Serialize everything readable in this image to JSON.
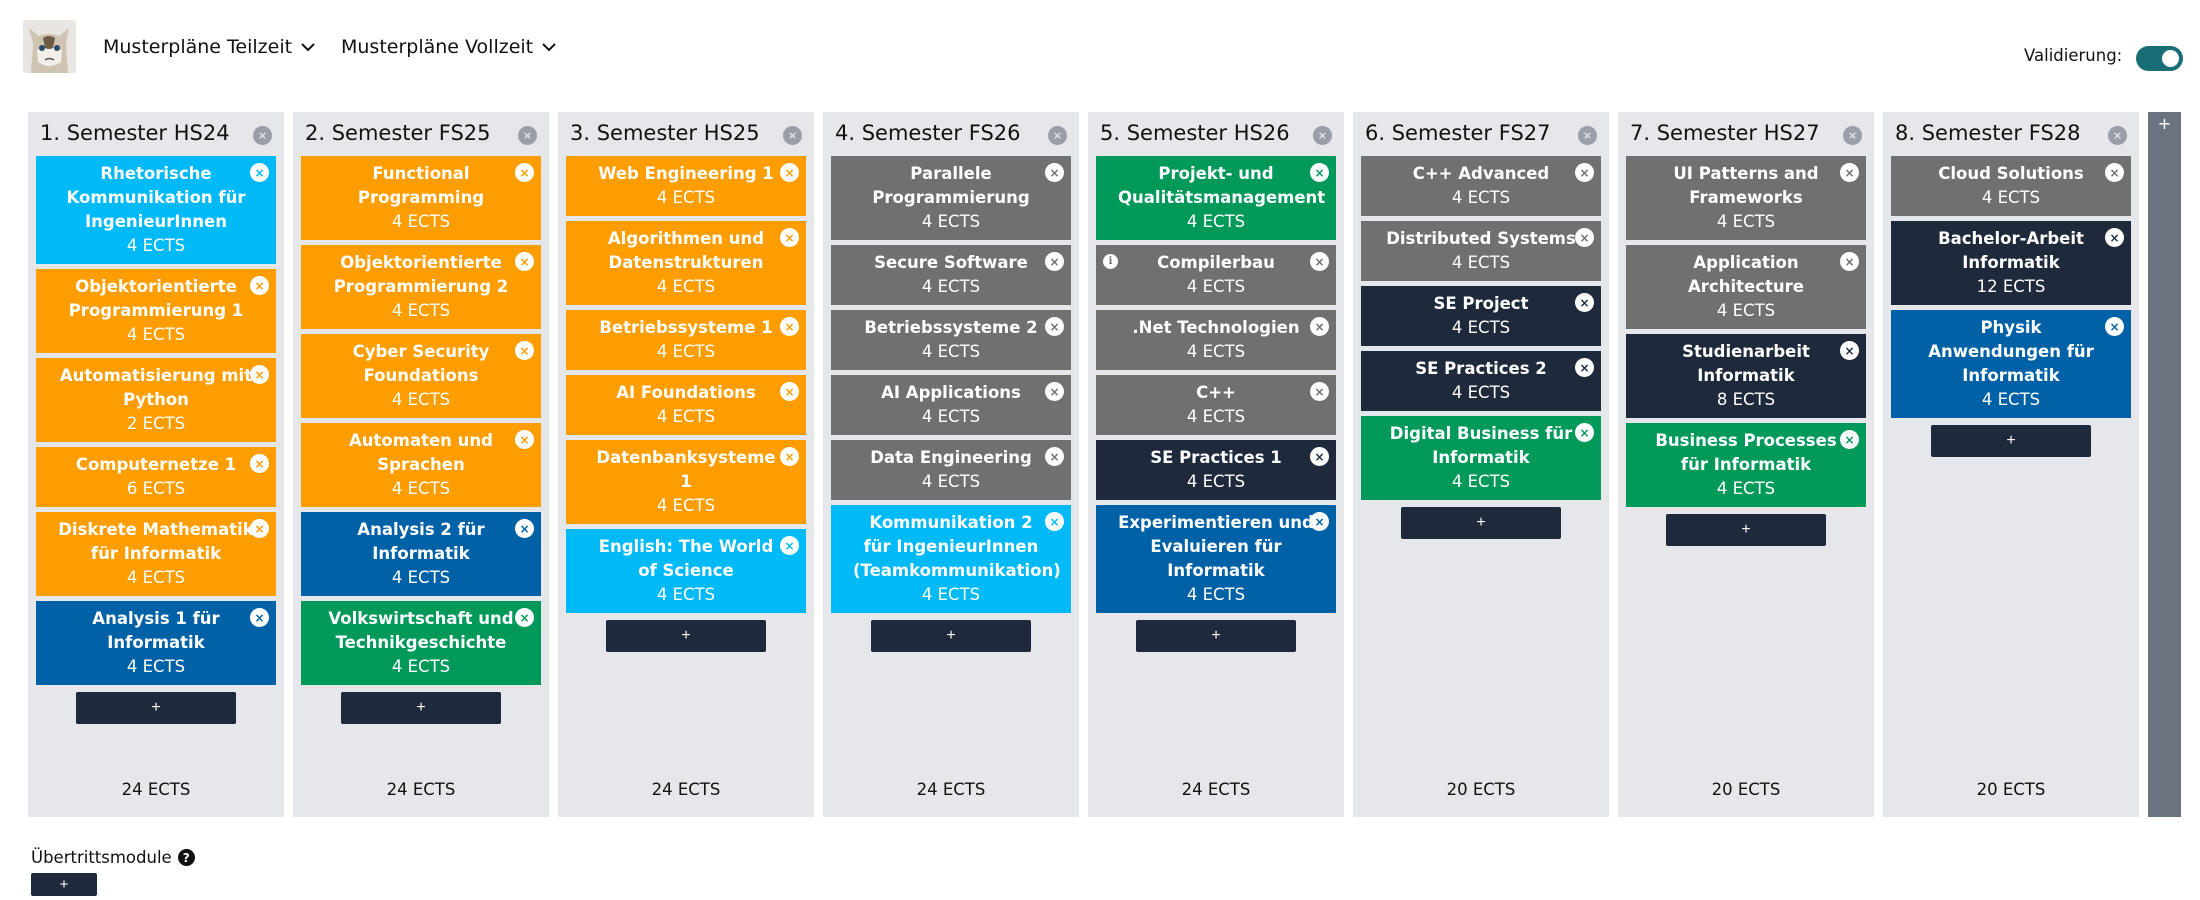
{
  "header": {
    "menu_parttime": "Musterpläne Teilzeit",
    "menu_fulltime": "Musterpläne Vollzeit",
    "validation_label": "Validierung:",
    "validation_on": true
  },
  "add_label": "+",
  "remove_glyph": "×",
  "info_glyph": "i",
  "semesters": [
    {
      "title": "1. Semester HS24",
      "total": "24 ECTS",
      "modules": [
        {
          "name": "Rhetorische Kommunikation für IngenieurInnen",
          "ects": "4 ECTS",
          "color": "cyan"
        },
        {
          "name": "Objektorientierte Programmierung 1",
          "ects": "4 ECTS",
          "color": "orange"
        },
        {
          "name": "Automatisierung mit Python",
          "ects": "2 ECTS",
          "color": "orange"
        },
        {
          "name": "Computernetze 1",
          "ects": "6 ECTS",
          "color": "orange"
        },
        {
          "name": "Diskrete Mathematik für Informatik",
          "ects": "4 ECTS",
          "color": "orange"
        },
        {
          "name": "Analysis 1 für Informatik",
          "ects": "4 ECTS",
          "color": "blue"
        }
      ]
    },
    {
      "title": "2. Semester FS25",
      "total": "24 ECTS",
      "modules": [
        {
          "name": "Functional Programming",
          "ects": "4 ECTS",
          "color": "orange"
        },
        {
          "name": "Objektorientierte Programmierung 2",
          "ects": "4 ECTS",
          "color": "orange"
        },
        {
          "name": "Cyber Security Foundations",
          "ects": "4 ECTS",
          "color": "orange"
        },
        {
          "name": "Automaten und Sprachen",
          "ects": "4 ECTS",
          "color": "orange"
        },
        {
          "name": "Analysis 2 für Informatik",
          "ects": "4 ECTS",
          "color": "blue"
        },
        {
          "name": "Volkswirtschaft und Technikgeschichte",
          "ects": "4 ECTS",
          "color": "green"
        }
      ]
    },
    {
      "title": "3. Semester HS25",
      "total": "24 ECTS",
      "modules": [
        {
          "name": "Web Engineering 1",
          "ects": "4 ECTS",
          "color": "orange"
        },
        {
          "name": "Algorithmen und Datenstrukturen",
          "ects": "4 ECTS",
          "color": "orange"
        },
        {
          "name": "Betriebssysteme 1",
          "ects": "4 ECTS",
          "color": "orange"
        },
        {
          "name": "AI Foundations",
          "ects": "4 ECTS",
          "color": "orange"
        },
        {
          "name": "Datenbanksysteme 1",
          "ects": "4 ECTS",
          "color": "orange"
        },
        {
          "name": "English: The World of Science",
          "ects": "4 ECTS",
          "color": "cyan"
        }
      ]
    },
    {
      "title": "4. Semester FS26",
      "total": "24 ECTS",
      "modules": [
        {
          "name": "Parallele Programmierung",
          "ects": "4 ECTS",
          "color": "gray"
        },
        {
          "name": "Secure Software",
          "ects": "4 ECTS",
          "color": "gray"
        },
        {
          "name": "Betriebssysteme 2",
          "ects": "4 ECTS",
          "color": "gray"
        },
        {
          "name": "AI Applications",
          "ects": "4 ECTS",
          "color": "gray"
        },
        {
          "name": "Data Engineering",
          "ects": "4 ECTS",
          "color": "gray"
        },
        {
          "name": "Kommunikation 2 für IngenieurInnen (Teamkommunikation)",
          "ects": "4 ECTS",
          "color": "cyan"
        }
      ]
    },
    {
      "title": "5. Semester HS26",
      "total": "24 ECTS",
      "modules": [
        {
          "name": "Projekt- und Qualitätsmanagement",
          "ects": "4 ECTS",
          "color": "green"
        },
        {
          "name": "Compilerbau",
          "ects": "4 ECTS",
          "color": "gray",
          "info": true
        },
        {
          "name": ".Net Technologien",
          "ects": "4 ECTS",
          "color": "gray"
        },
        {
          "name": "C++",
          "ects": "4 ECTS",
          "color": "gray"
        },
        {
          "name": "SE Practices 1",
          "ects": "4 ECTS",
          "color": "navy"
        },
        {
          "name": "Experimentieren und Evaluieren für Informatik",
          "ects": "4 ECTS",
          "color": "blue"
        }
      ]
    },
    {
      "title": "6. Semester FS27",
      "total": "20 ECTS",
      "modules": [
        {
          "name": "C++ Advanced",
          "ects": "4 ECTS",
          "color": "gray"
        },
        {
          "name": "Distributed Systems",
          "ects": "4 ECTS",
          "color": "gray"
        },
        {
          "name": "SE Project",
          "ects": "4 ECTS",
          "color": "navy"
        },
        {
          "name": "SE Practices 2",
          "ects": "4 ECTS",
          "color": "navy"
        },
        {
          "name": "Digital Business für Informatik",
          "ects": "4 ECTS",
          "color": "green"
        }
      ]
    },
    {
      "title": "7. Semester HS27",
      "total": "20 ECTS",
      "modules": [
        {
          "name": "UI Patterns and Frameworks",
          "ects": "4 ECTS",
          "color": "gray"
        },
        {
          "name": "Application Architecture",
          "ects": "4 ECTS",
          "color": "gray"
        },
        {
          "name": "Studienarbeit Informatik",
          "ects": "8 ECTS",
          "color": "navy"
        },
        {
          "name": "Business Processes für Informatik",
          "ects": "4 ECTS",
          "color": "green"
        }
      ]
    },
    {
      "title": "8. Semester FS28",
      "total": "20 ECTS",
      "modules": [
        {
          "name": "Cloud Solutions",
          "ects": "4 ECTS",
          "color": "gray"
        },
        {
          "name": "Bachelor-Arbeit Informatik",
          "ects": "12 ECTS",
          "color": "navy"
        },
        {
          "name": "Physik Anwendungen für Informatik",
          "ects": "4 ECTS",
          "color": "blue"
        }
      ]
    }
  ],
  "transfer": {
    "label": "Übertrittsmodule",
    "help": "?"
  },
  "colors": {
    "orange": "#fd9d00",
    "cyan": "#00b9f7",
    "blue": "#0061a6",
    "green": "#00995a",
    "gray": "#707070",
    "navy": "#1e293b",
    "toggle": "#196d74"
  },
  "icons": {
    "avatar": "grumpy-cat-avatar",
    "menu": "chevron-down-icon",
    "remove": "close-circle-icon",
    "info": "info-icon"
  }
}
